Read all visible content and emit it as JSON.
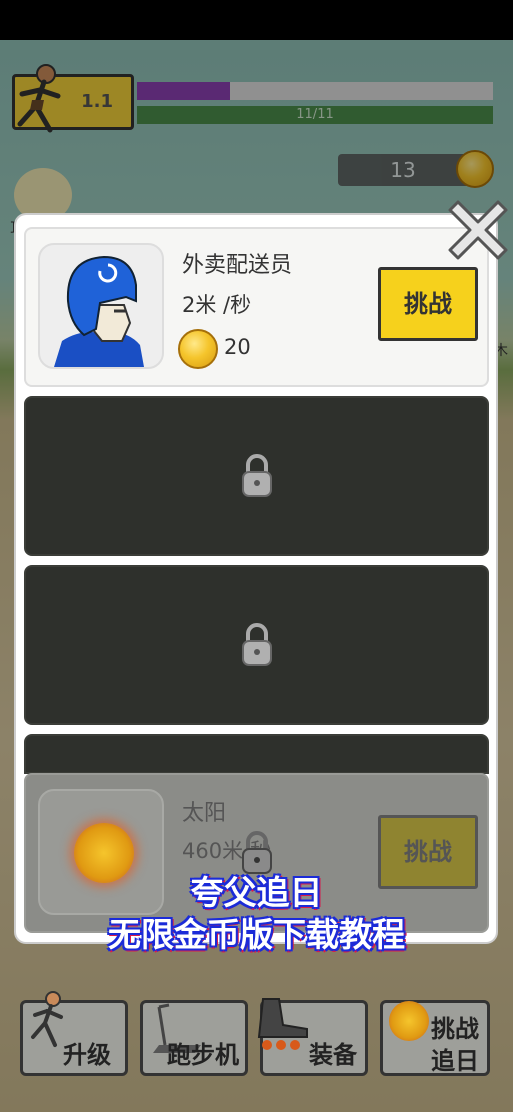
{
  "hud": {
    "level": "1.1",
    "xp_fraction": 0.26,
    "hp_text": "11/11",
    "coins": "13"
  },
  "runners": [
    {
      "name": "外卖配送员",
      "speed": "2米 /秒",
      "price": "20",
      "button": "挑战",
      "locked": false
    },
    {
      "locked": true
    },
    {
      "locked": true
    },
    {
      "name": "太阳",
      "speed": "460米/秒",
      "button": "挑战",
      "locked": true
    }
  ],
  "bottom_nav": {
    "upgrade": "升级",
    "treadmill": "跑步机",
    "equipment": "装备",
    "chase_line1": "挑战",
    "chase_line2": "追日"
  },
  "subtitle": {
    "line1": "夸父追日",
    "line2": "无限金币版下载教程"
  },
  "colors": {
    "challenge_button": "#f6d11c",
    "locked_card": "#2e302c",
    "xp_bar": "#8b3fb1",
    "hp_bar": "#4a8c4a"
  }
}
